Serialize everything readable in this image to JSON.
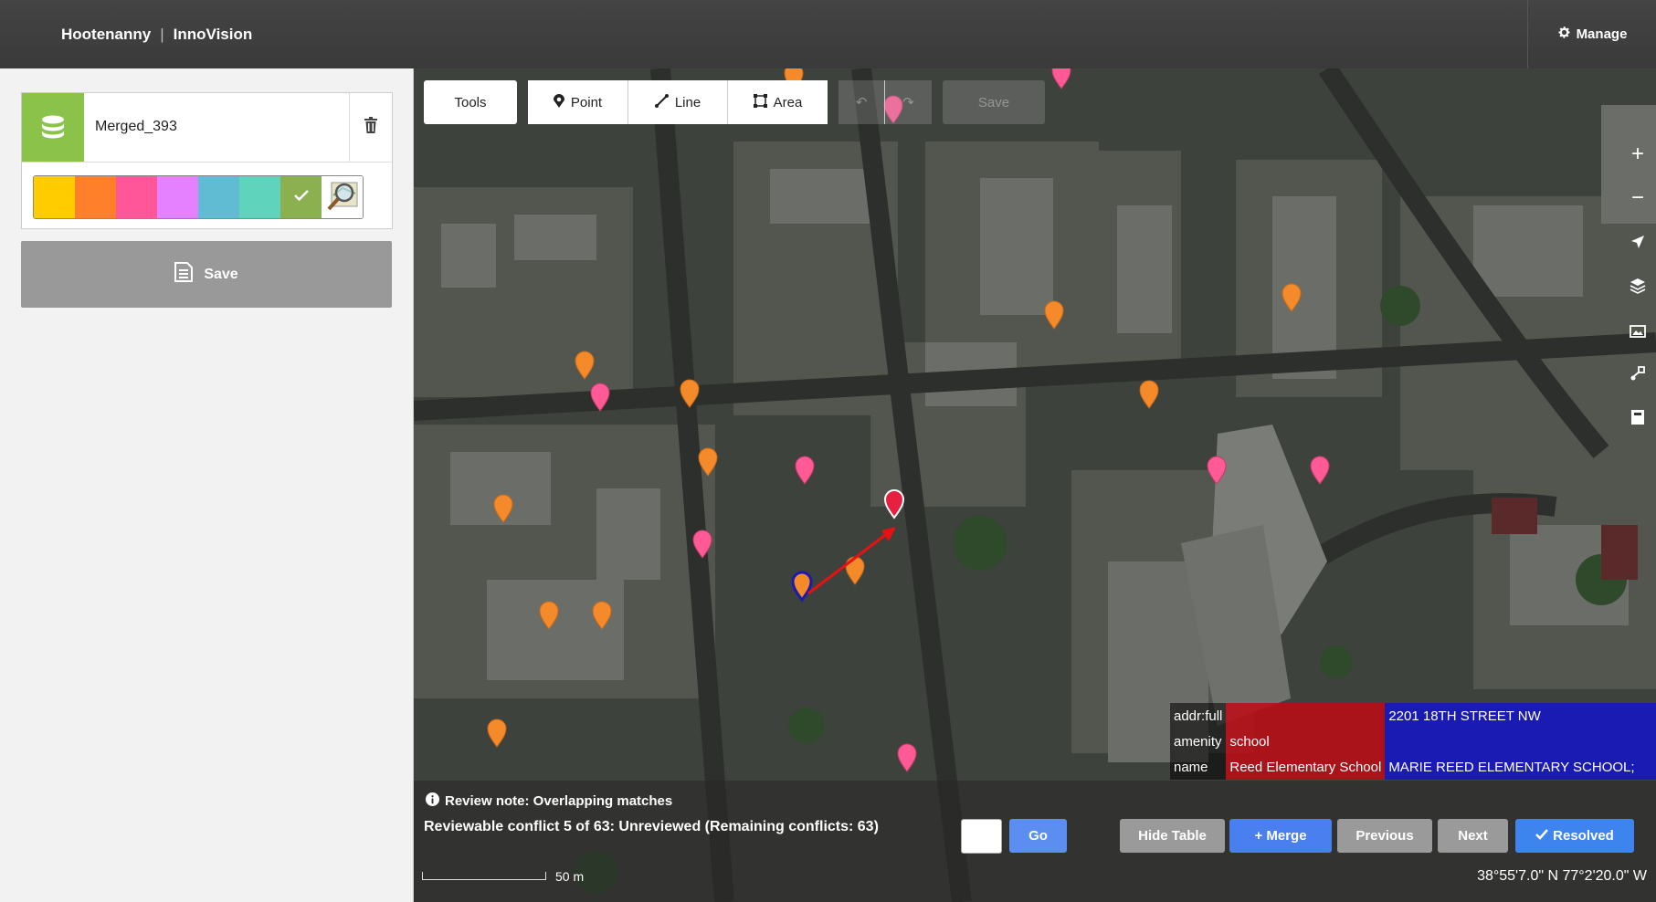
{
  "header": {
    "brand": "Hootenanny",
    "separator": "|",
    "product": "InnoVision",
    "manage_label": "Manage"
  },
  "sidebar": {
    "layer": {
      "name": "Merged_393",
      "color": "#8bc34a"
    },
    "palette": [
      {
        "color": "#ffcc00"
      },
      {
        "color": "#ff7f2a"
      },
      {
        "color": "#ff5599"
      },
      {
        "color": "#e580ff"
      },
      {
        "color": "#5fbcd3"
      },
      {
        "color": "#5fd3bc"
      },
      {
        "color": "#8bb050",
        "selected": true
      },
      {
        "color": "#ffffff",
        "icon": "magnifier-map-icon"
      }
    ],
    "save_label": "Save"
  },
  "map": {
    "toolbar": {
      "tools_label": "Tools",
      "point_label": "Point",
      "line_label": "Line",
      "area_label": "Area",
      "save_label": "Save"
    },
    "side_tools": [
      "zoom-in-icon",
      "zoom-out-icon",
      "locate-icon",
      "layers-icon",
      "background-icon",
      "data-icon",
      "measure-icon"
    ],
    "tag_table": {
      "rows": [
        {
          "key": "addr:full",
          "a": "",
          "b": "2201 18TH STREET NW"
        },
        {
          "key": "amenity",
          "a": "school",
          "b": ""
        },
        {
          "key": "name",
          "a": "Reed Elementary School",
          "b": "MARIE REED ELEMENTARY SCHOOL;"
        }
      ]
    },
    "review": {
      "note": "Review note: Overlapping matches",
      "status": "Reviewable conflict 5 of 63: Unreviewed (Remaining conflicts: 63)",
      "go_label": "Go",
      "hide_table_label": "Hide Table",
      "merge_label": "+ Merge",
      "previous_label": "Previous",
      "next_label": "Next",
      "resolved_label": "Resolved"
    },
    "scale_label": "50 m",
    "coordinates": "38°55'7.0\" N 77°2'20.0\" W"
  }
}
